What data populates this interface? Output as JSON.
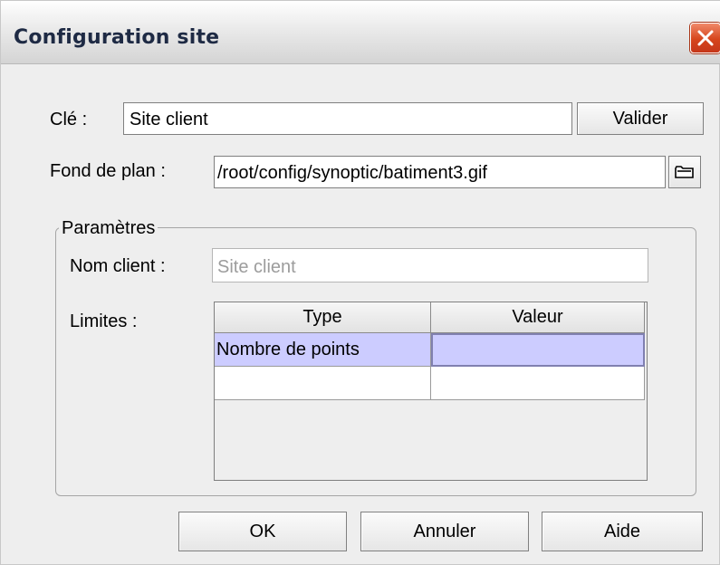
{
  "window": {
    "title": "Configuration site",
    "close_icon": "close-icon"
  },
  "form": {
    "cle_label": "Clé :",
    "cle_value": "Site client",
    "valider_label": "Valider",
    "fond_label": "Fond de plan :",
    "fond_value": "/root/config/synoptic/batiment3.gif",
    "browse_icon": "folder-icon"
  },
  "parametres": {
    "title": "Paramètres",
    "nom_label": "Nom client :",
    "nom_value": "Site client",
    "limites_label": "Limites :",
    "table": {
      "columns": [
        "Type",
        "Valeur"
      ],
      "rows": [
        [
          "Nombre de points",
          ""
        ],
        [
          "",
          ""
        ]
      ]
    }
  },
  "buttons": {
    "ok": "OK",
    "annuler": "Annuler",
    "aide": "Aide"
  },
  "colors": {
    "selection": "#ccccff",
    "close": "#d6451c",
    "background": "#eeeeee"
  }
}
